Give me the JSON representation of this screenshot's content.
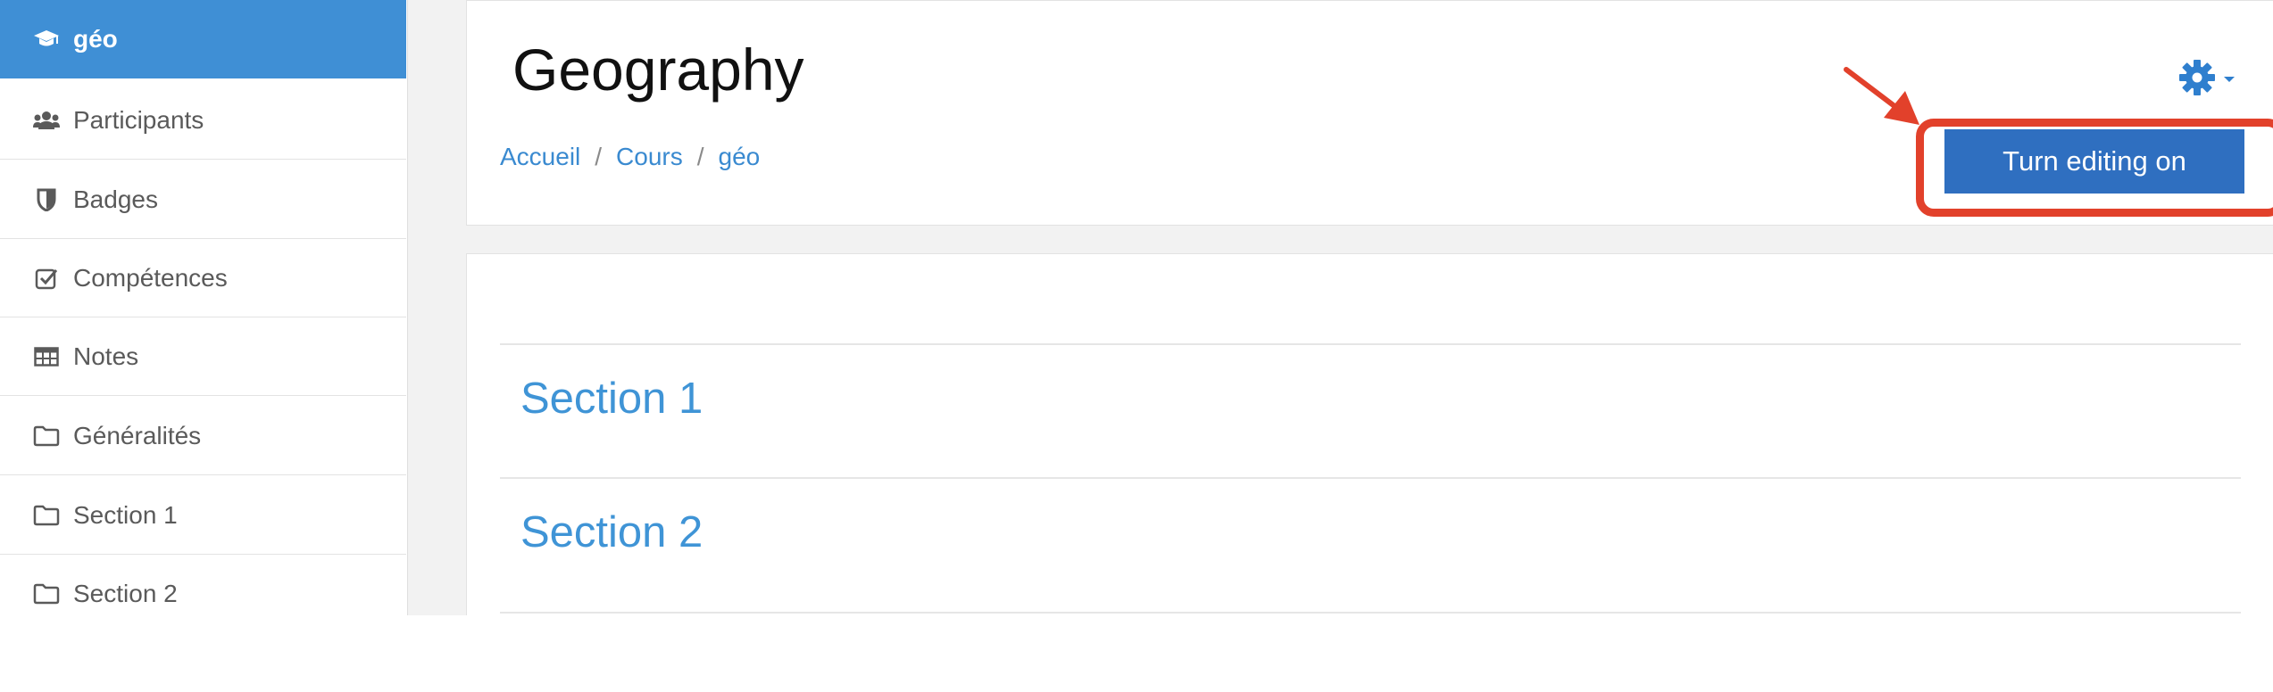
{
  "sidebar": {
    "items": [
      {
        "label": "géo",
        "icon": "graduation-cap-icon"
      },
      {
        "label": "Participants",
        "icon": "users-icon"
      },
      {
        "label": "Badges",
        "icon": "shield-icon"
      },
      {
        "label": "Compétences",
        "icon": "checkbox-icon"
      },
      {
        "label": "Notes",
        "icon": "table-icon"
      },
      {
        "label": "Généralités",
        "icon": "folder-icon"
      },
      {
        "label": "Section 1",
        "icon": "folder-icon"
      },
      {
        "label": "Section 2",
        "icon": "folder-icon"
      }
    ]
  },
  "header": {
    "title": "Geography",
    "breadcrumb": [
      "Accueil",
      "Cours",
      "géo"
    ],
    "breadcrumb_separator": "/",
    "settings_icon": "gear-icon",
    "edit_button_label": "Turn editing on"
  },
  "content": {
    "sections": [
      "Section 1",
      "Section 2"
    ]
  },
  "colors": {
    "accent": "#3f8fd5",
    "button": "#2f6fc0",
    "link": "#3a8ad0",
    "annotation": "#e2412b"
  }
}
